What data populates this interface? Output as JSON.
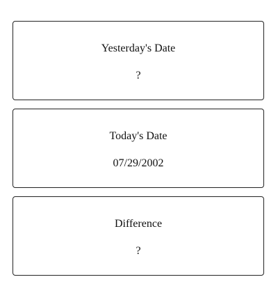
{
  "cards": {
    "yesterday": {
      "title": "Yesterday's Date",
      "value": "?"
    },
    "today": {
      "title": "Today's Date",
      "value": "07/29/2002"
    },
    "difference": {
      "title": "Difference",
      "value": "?"
    }
  }
}
